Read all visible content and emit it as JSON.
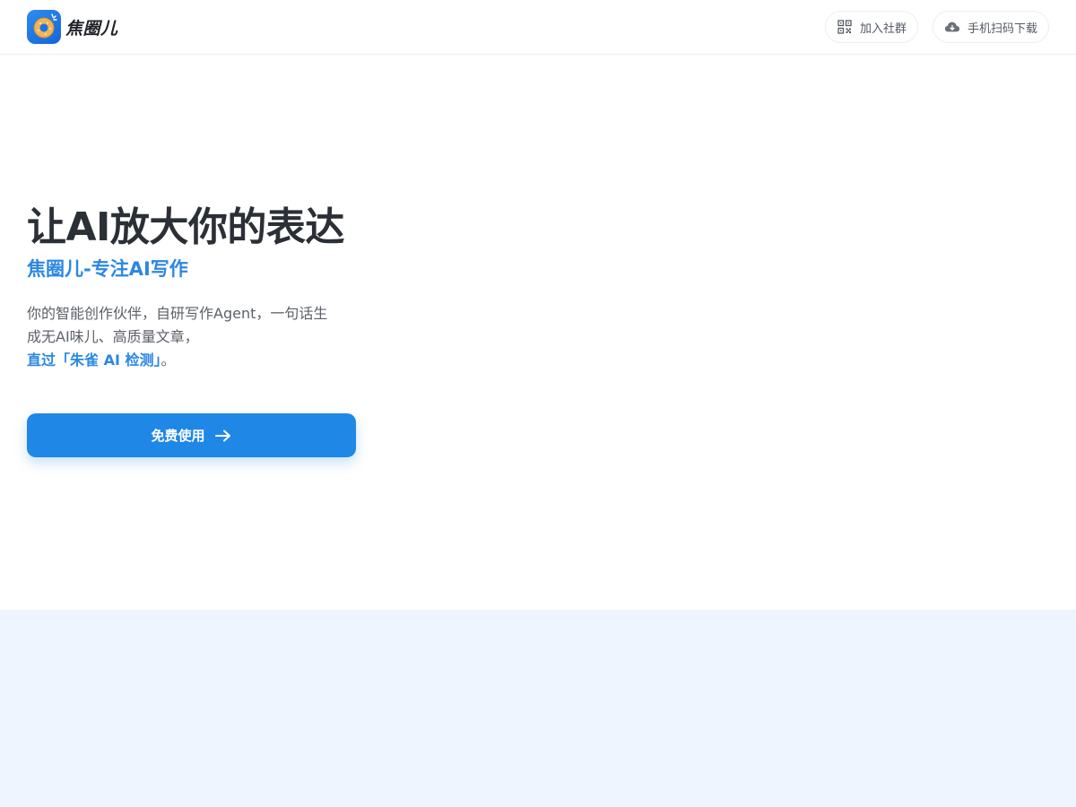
{
  "brand": {
    "name": "焦圈儿",
    "accent_color": "#1f87e6",
    "logo_icon": "donut-logo-icon"
  },
  "header": {
    "actions": [
      {
        "label": "加入社群",
        "icon": "qr-code-icon"
      },
      {
        "label": "手机扫码下载",
        "icon": "cloud-download-icon"
      }
    ]
  },
  "hero": {
    "title": "让AI放大你的表达",
    "subtitle": "焦圈儿-专注AI写作",
    "description_line1": "你的智能创作伙伴，自研写作Agent，一句话生",
    "description_line2": "成无AI味儿、高质量文章，",
    "description_highlight": "直过「朱雀 AI 检测」",
    "description_end": "。",
    "cta_label": "免费使用",
    "cta_icon": "arrow-right-icon"
  },
  "colors": {
    "title": "#2b2f36",
    "subtitle": "#2b87e3",
    "lower_section_bg": "#eef5fe"
  }
}
